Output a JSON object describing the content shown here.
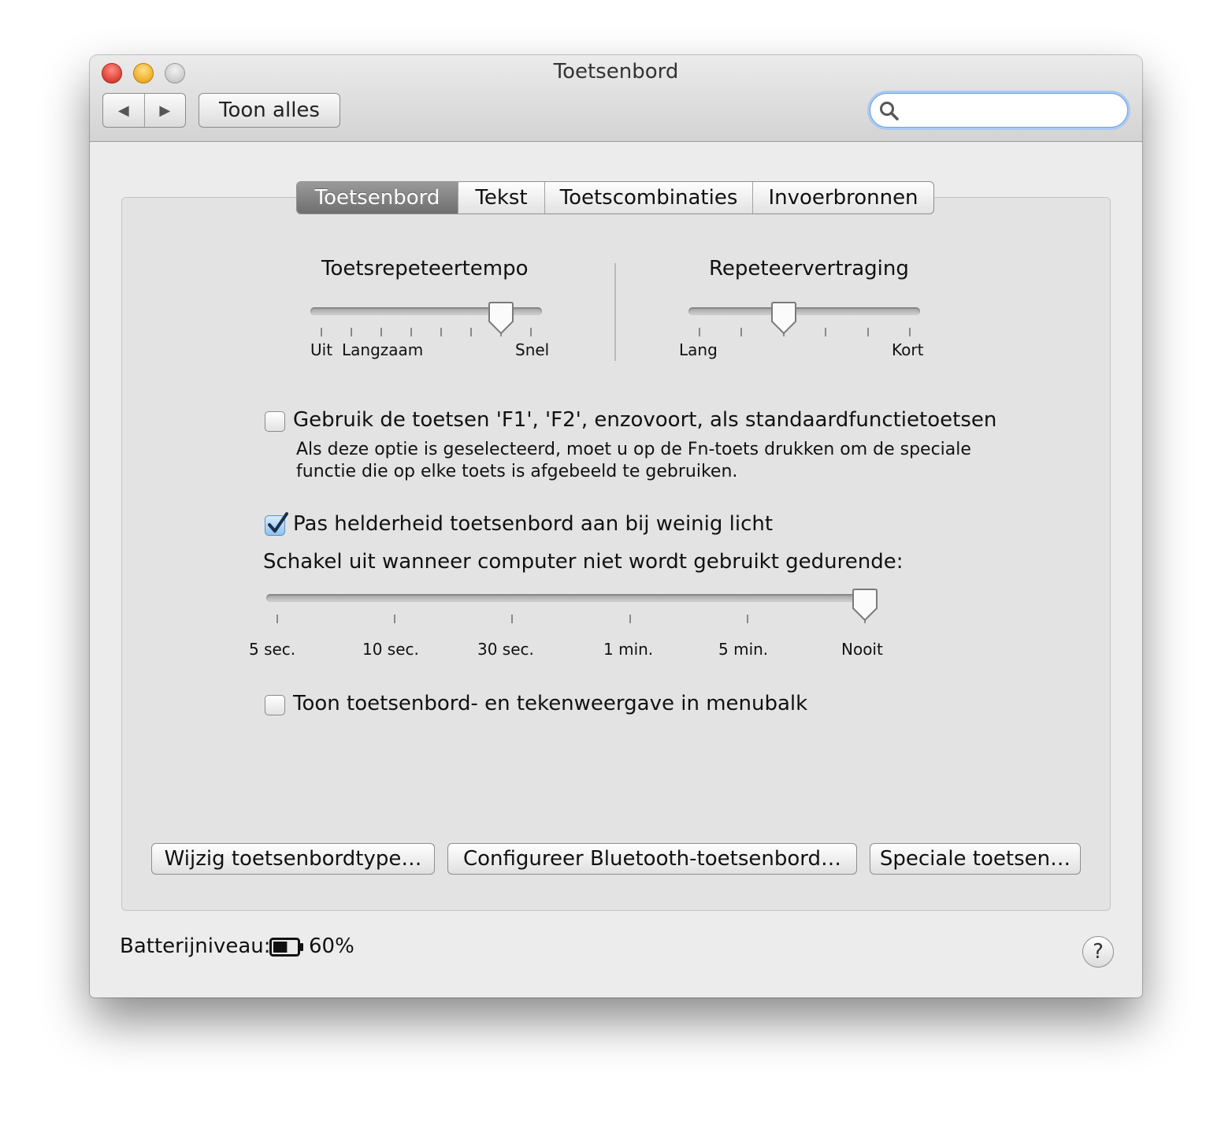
{
  "window": {
    "title": "Toetsenbord"
  },
  "toolbar": {
    "back_icon": "◀",
    "forward_icon": "▶",
    "show_all_label": "Toon alles",
    "search": {
      "value": "",
      "placeholder": ""
    }
  },
  "tabs": [
    {
      "label": "Toetsenbord",
      "active": true
    },
    {
      "label": "Tekst",
      "active": false
    },
    {
      "label": "Toetscombinaties",
      "active": false
    },
    {
      "label": "Invoerbronnen",
      "active": false
    }
  ],
  "key_repeat": {
    "title": "Toetsrepeteertempo",
    "labels": [
      "Uit",
      "Langzaam",
      "Snel"
    ],
    "tick_count": 8,
    "selected_tick": 6
  },
  "repeat_delay": {
    "title": "Repeteervertraging",
    "labels": [
      "Lang",
      "Kort"
    ],
    "tick_count": 6,
    "selected_tick": 2
  },
  "fn_keys": {
    "checked": false,
    "label": "Gebruik de toetsen 'F1', 'F2', enzovoort, als standaardfunctietoetsen",
    "description_line1": "Als deze optie is geselecteerd, moet u op de Fn-toets drukken om de speciale",
    "description_line2": "functie die op elke toets is afgebeeld te gebruiken."
  },
  "brightness": {
    "checked": true,
    "label": "Pas helderheid toetsenbord aan bij weinig licht"
  },
  "idle_off": {
    "title": "Schakel uit wanneer computer niet wordt gebruikt gedurende:",
    "labels": [
      "5 sec.",
      "10 sec.",
      "30 sec.",
      "1 min.",
      "5 min.",
      "Nooit"
    ],
    "selected_index": 5
  },
  "menubar_viewer": {
    "checked": false,
    "label": "Toon toetsenbord- en tekenweergave in menubalk"
  },
  "buttons": {
    "change_type": "Wijzig toetsenbordtype…",
    "bluetooth": "Configureer Bluetooth-toetsenbord…",
    "special_keys": "Speciale toetsen…"
  },
  "battery": {
    "label": "Batterijniveau:",
    "percent_text": "60%",
    "level": 0.6
  },
  "help_label": "?",
  "icons": {
    "search": "search-icon",
    "battery": "battery-icon",
    "help": "help-icon",
    "checkmark": "checkmark-icon"
  }
}
